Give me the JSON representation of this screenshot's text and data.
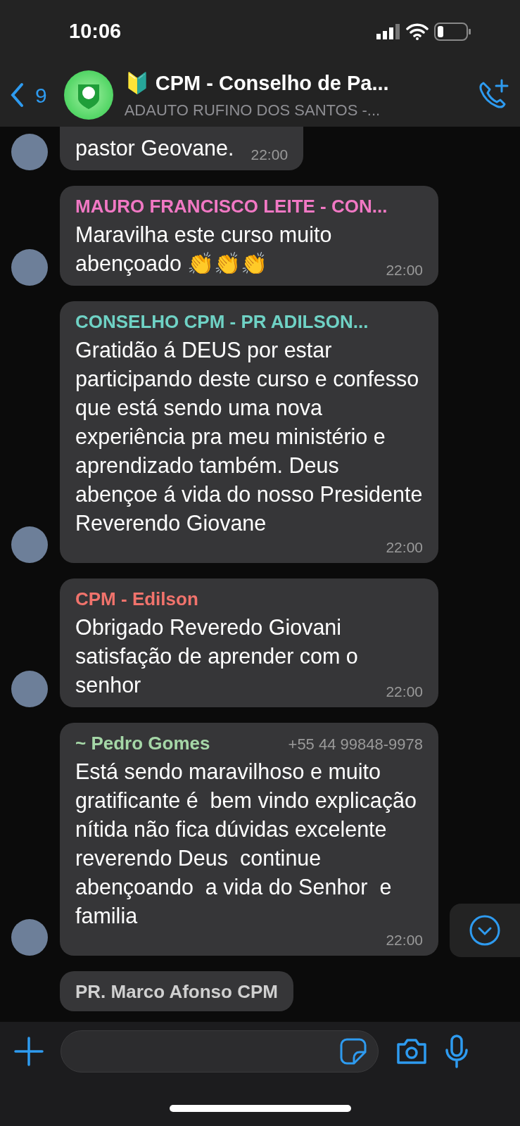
{
  "status_bar": {
    "time": "10:06"
  },
  "header": {
    "back_count": "9",
    "title": "🔰 CPM - Conselho de Pa...",
    "subtitle": "ADAUTO RUFINO DOS SANTOS -..."
  },
  "messages": [
    {
      "text": "pastor Geovane.",
      "time": "22:00",
      "avatar": true
    },
    {
      "sender": "MAURO FRANCISCO LEITE - CON...",
      "color": "#f178c4",
      "text": "Maravilha este curso muito abençoado 👏👏👏",
      "time": "22:00",
      "avatar": true
    },
    {
      "sender": "CONSELHO CPM - PR ADILSON...",
      "color": "#6fd2c5",
      "text": "Gratidão á DEUS por estar participando deste curso e confesso que está sendo uma nova experiência pra meu ministério e aprendizado também. Deus abençoe á vida do nosso Presidente Reverendo Giovane",
      "time": "22:00",
      "avatar": true
    },
    {
      "sender": "CPM - Edilson",
      "color": "#f1736c",
      "text": "Obrigado Reveredo Giovani satisfação de aprender com o senhor",
      "time": "22:00",
      "avatar": true
    },
    {
      "sender": "~ Pedro Gomes",
      "color": "#a5d7a7",
      "phone": "+55 44 99848-9978",
      "text": "Está sendo maravilhoso e muito gratificante é  bem vindo explicação  nítida não fica dúvidas excelente reverendo Deus  continue  abençoando  a vida do Senhor  e familia",
      "time": "22:00",
      "avatar": true
    },
    {
      "sender": "PR. Marco Afonso CPM",
      "color": "#d0d0d0",
      "avatar": false
    }
  ]
}
